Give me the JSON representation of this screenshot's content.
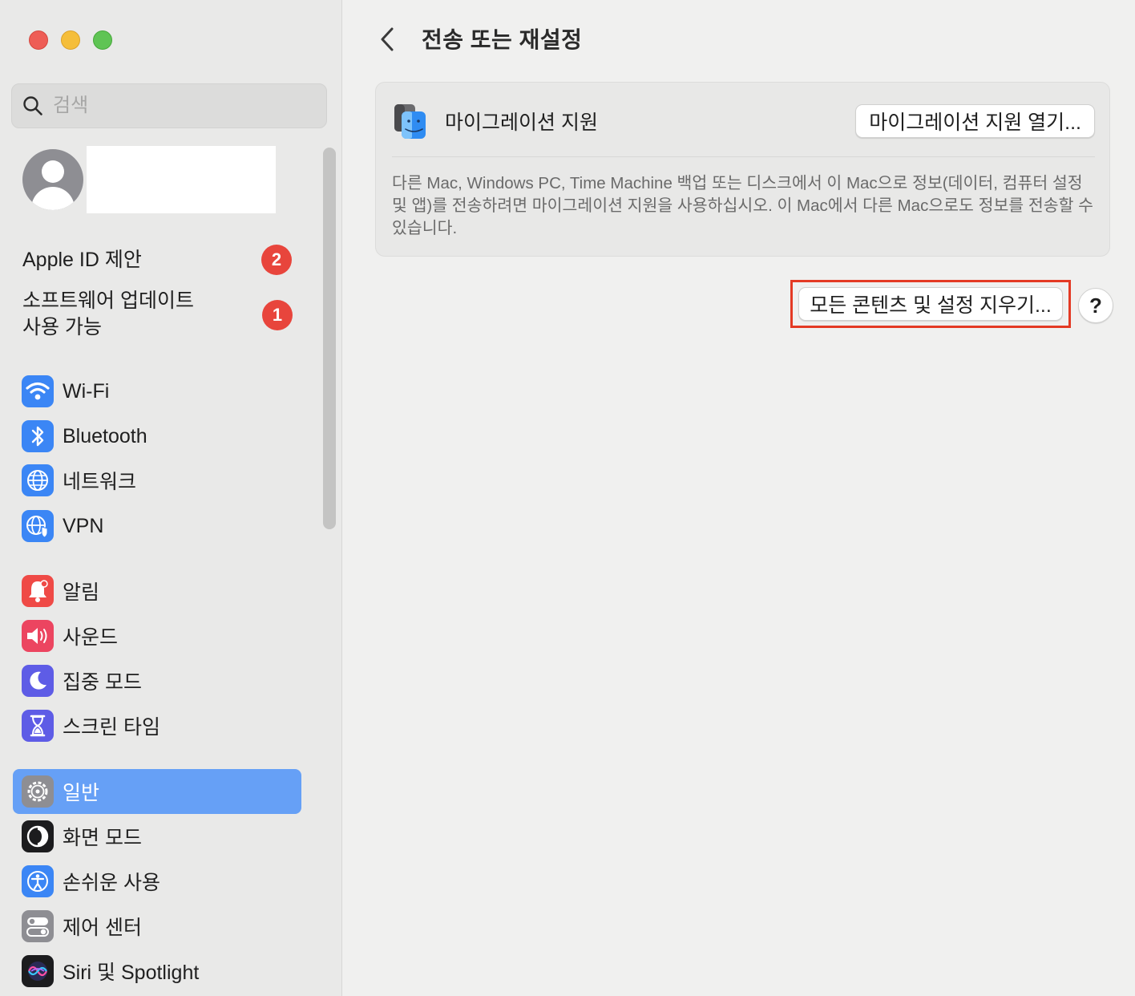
{
  "search": {
    "placeholder": "검색"
  },
  "notices": [
    {
      "label": "Apple ID 제안",
      "badge": "2"
    },
    {
      "label_line1": "소프트웨어 업데이트",
      "label_line2": "사용 가능",
      "badge": "1"
    }
  ],
  "sidebar": {
    "items": [
      {
        "label": "Wi-Fi",
        "icon": "wifi-icon"
      },
      {
        "label": "Bluetooth",
        "icon": "bluetooth-icon"
      },
      {
        "label": "네트워크",
        "icon": "network-globe-icon"
      },
      {
        "label": "VPN",
        "icon": "vpn-globe-icon"
      },
      {
        "label": "알림",
        "icon": "bell-icon"
      },
      {
        "label": "사운드",
        "icon": "speaker-icon"
      },
      {
        "label": "집중 모드",
        "icon": "moon-icon"
      },
      {
        "label": "스크린 타임",
        "icon": "hourglass-icon"
      },
      {
        "label": "일반",
        "icon": "gear-icon",
        "selected": true
      },
      {
        "label": "화면 모드",
        "icon": "appearance-icon"
      },
      {
        "label": "손쉬운 사용",
        "icon": "accessibility-icon"
      },
      {
        "label": "제어 센터",
        "icon": "toggles-icon"
      },
      {
        "label": "Siri 및 Spotlight",
        "icon": "siri-icon"
      }
    ]
  },
  "header": {
    "title": "전송 또는 재설정"
  },
  "migration": {
    "title": "마이그레이션 지원",
    "open_button": "마이그레이션 지원 열기...",
    "description": "다른 Mac, Windows PC, Time Machine 백업 또는 디스크에서 이 Mac으로 정보(데이터, 컴퓨터 설정 및 앱)를 전송하려면 마이그레이션 지원을 사용하십시오. 이 Mac에서 다른 Mac으로도 정보를 전송할 수 있습니다."
  },
  "erase": {
    "button": "모든 콘텐츠 및 설정 지우기..."
  },
  "help": {
    "label": "?"
  },
  "colors": {
    "accent": "#66a0f6",
    "badge": "#e8453c",
    "highlight": "#e43a24"
  }
}
